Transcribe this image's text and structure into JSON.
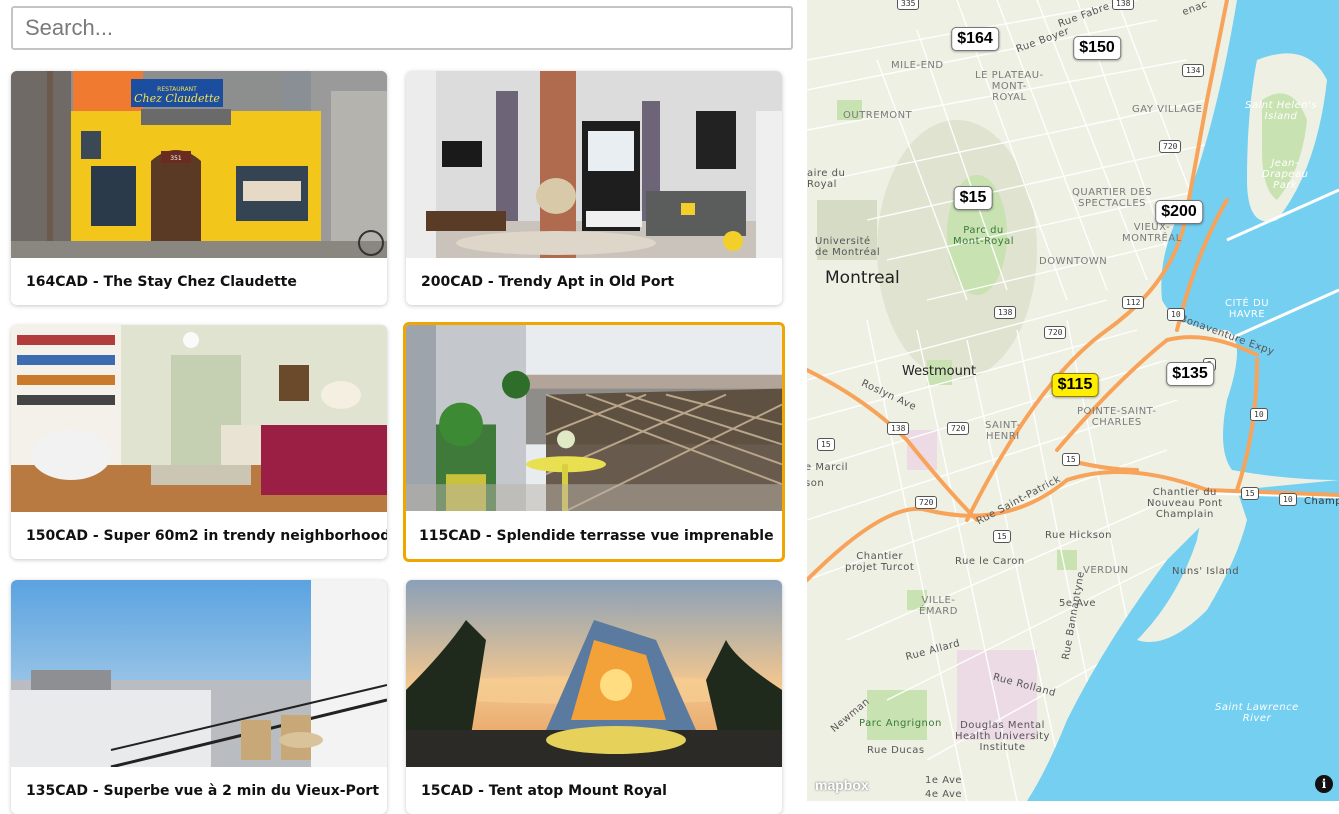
{
  "search": {
    "placeholder": "Search...",
    "value": ""
  },
  "listings": [
    {
      "title": "164CAD - The Stay Chez Claudette",
      "price": "164",
      "sign": "Chez Claudette",
      "sign_top": "RESTAURANT",
      "number": "351"
    },
    {
      "title": "200CAD - Trendy Apt in Old Port",
      "price": "200"
    },
    {
      "title": "150CAD - Super 60m2 in trendy neighborhood!",
      "price": "150"
    },
    {
      "title": "115CAD - Splendide terrasse vue imprenable",
      "price": "115",
      "selected": true
    },
    {
      "title": "135CAD - Superbe vue à 2 min du Vieux-Port",
      "price": "135"
    },
    {
      "title": "15CAD - Tent atop Mount Royal",
      "price": "15"
    }
  ],
  "map": {
    "markers": [
      {
        "label": "$164"
      },
      {
        "label": "$150"
      },
      {
        "label": "$15"
      },
      {
        "label": "$200"
      },
      {
        "label": "$115",
        "active": true
      },
      {
        "label": "$135"
      }
    ],
    "places": {
      "montreal": "Montreal",
      "westmount": "Westmount",
      "mile_end": "MILE-END",
      "plateau": "LE PLATEAU-\nMONT-\nROYAL",
      "outremont": "OUTREMONT",
      "gay_village": "GAY VILLAGE",
      "saint_helens": "Saint Helen's\nIsland",
      "jean_drapeau": "Jean-\nDrapeau\nPark",
      "quartier": "QUARTIER DES\nSPECTACLES",
      "vieux": "VIEUX-\nMONTRÉAL",
      "downtown": "DOWNTOWN",
      "cite_du_havre": "CITÉ DU\nHAVRE",
      "parc_mont_royal": "Parc du\nMont-Royal",
      "universite": "Université\nde Montréal",
      "aire": "aire du\nRoyal",
      "pointe": "POINTE-SAINT-\nCHARLES",
      "saint_henri": "SAINT-\nHENRI",
      "chantier_champlain": "Chantier du\nNouveau Pont\nChamplain",
      "verdun": "VERDUN",
      "nuns": "Nuns' Island",
      "chantier_turcot": "Chantier\nprojet Turcot",
      "ville_emard": "VILLE-\nÉMARD",
      "parc_angrignon": "Parc Angrignon",
      "douglas": "Douglas Mental\nHealth University\nInstitute",
      "saint_lawrence": "Saint Lawrence\nRiver",
      "rue_fabre": "Rue Fabre",
      "rue_boyer": "Rue Boyer",
      "rue_st_patrick": "Rue Saint-Patrick",
      "rue_hickson": "Rue Hickson",
      "rue_le_caron": "Rue le Caron",
      "rue_allard": "Rue Allard",
      "rue_rolland": "Rue Rolland",
      "rue_ducas": "Rue Ducas",
      "bannantyne": "Rue Bannantyne",
      "roslyn": "Roslyn Ave",
      "bonaventure": "Bonaventure Expy",
      "newman": "Newman",
      "marcil": "e Marcil",
      "fifth_ave": "5e Ave",
      "first_ave": "1e Ave",
      "fourth_ave": "4e Ave",
      "lenac": "enac",
      "son": "son",
      "champ": "Champ",
      "r335": "335",
      "r138a": "138",
      "r134": "134",
      "r720a": "720",
      "r138b": "138",
      "r720b": "720",
      "r112": "112",
      "r10a": "10",
      "r10b": "10",
      "r138c": "138",
      "r720c": "720",
      "r15a": "15",
      "r15b": "15",
      "r720d": "720",
      "r15c": "15",
      "r15d": "15",
      "r10c": "10",
      "r2": "2"
    },
    "attribution": "mapbox",
    "info_icon": "i"
  },
  "colors": {
    "accent": "#f0a500",
    "marker_active": "#ffee00",
    "water": "#75cff0",
    "highway": "#f8a35a"
  }
}
